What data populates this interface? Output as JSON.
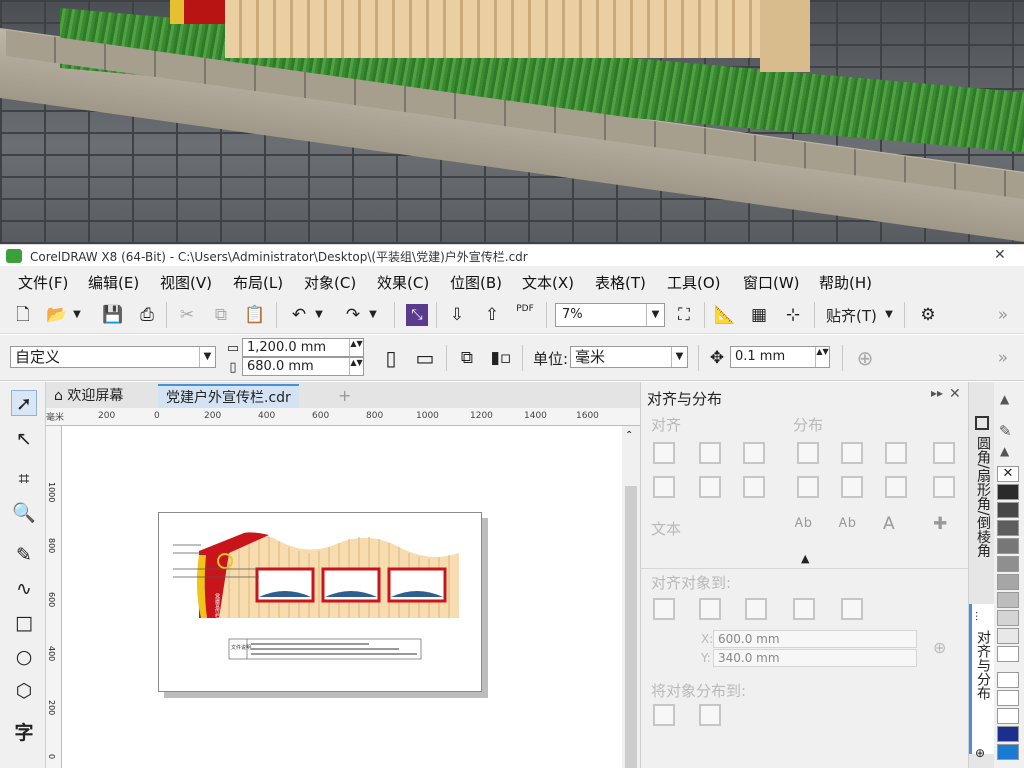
{
  "window": {
    "title": "CorelDRAW X8 (64-Bit) - C:\\Users\\Administrator\\Desktop\\(平装组\\党建)户外宣传栏.cdr"
  },
  "menu": [
    "文件(F)",
    "编辑(E)",
    "视图(V)",
    "布局(L)",
    "对象(C)",
    "效果(C)",
    "位图(B)",
    "文本(X)",
    "表格(T)",
    "工具(O)",
    "窗口(W)",
    "帮助(H)"
  ],
  "toolbar": {
    "zoom": "7%",
    "snap_label": "贴齐(T)",
    "pdf_label": "PDF"
  },
  "propbar": {
    "preset": "自定义",
    "width": "1,200.0 mm",
    "height": "680.0 mm",
    "units_label": "单位:",
    "units": "毫米",
    "nudge": "0.1 mm"
  },
  "tabs": [
    {
      "label": "欢迎屏幕"
    },
    {
      "label": "党建户外宣传栏.cdr"
    }
  ],
  "ruler": {
    "unit": "毫米",
    "ticks": [
      "200",
      "0",
      "200",
      "400",
      "600",
      "800",
      "1000",
      "1200",
      "1400",
      "1600"
    ],
    "vticks": [
      "1000",
      "800",
      "600",
      "400",
      "200",
      "0"
    ]
  },
  "artwork": {
    "sign_text": "党建宣传栏",
    "info_label": "文件说明"
  },
  "docker": {
    "title": "对齐与分布",
    "align_label": "对齐",
    "distribute_label": "分布",
    "text_label": "文本",
    "align_to_label": "对齐对象到:",
    "x_label": "X:",
    "x_value": "600.0 mm",
    "y_label": "Y:",
    "y_value": "340.0 mm",
    "distribute_to_label": "将对象分布到:"
  },
  "side_tabs": [
    "圆角/扇形角/倒棱角",
    "对齐与分布"
  ],
  "colors": {
    "accent": "#c9141b",
    "palette": [
      "#ffffff",
      "#2a2a2a",
      "#474747",
      "#5e5e5e",
      "#777777",
      "#8f8f8f",
      "#a6a6a6",
      "#bdbdbd",
      "#d4d4d4",
      "#e8e8e8",
      "#ffffff",
      "#1b2f8c",
      "#1a7bd1"
    ]
  }
}
